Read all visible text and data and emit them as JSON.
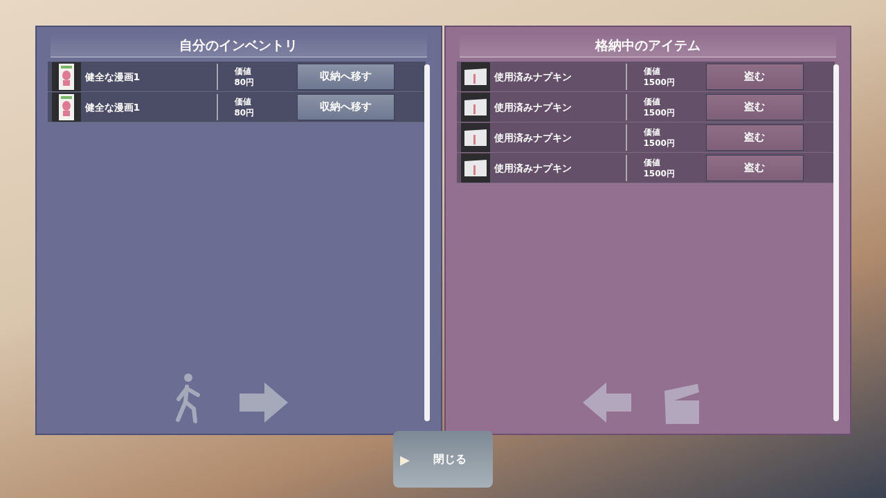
{
  "panels": [
    {
      "kind": "inventory",
      "title": "自分のインベントリ",
      "items": [
        {
          "kind": "comic",
          "name": "健全な漫画1",
          "value_label": "価値",
          "value": "80円",
          "action": "収納へ移す"
        },
        {
          "kind": "comic",
          "name": "健全な漫画1",
          "value_label": "価値",
          "value": "80円",
          "action": "収納へ移す"
        }
      ]
    },
    {
      "kind": "storage",
      "title": "格納中のアイテム",
      "items": [
        {
          "kind": "napkin",
          "name": "使用済みナプキン",
          "value_label": "価値",
          "value": "1500円",
          "action": "盗む"
        },
        {
          "kind": "napkin",
          "name": "使用済みナプキン",
          "value_label": "価値",
          "value": "1500円",
          "action": "盗む"
        },
        {
          "kind": "napkin",
          "name": "使用済みナプキン",
          "value_label": "価値",
          "value": "1500円",
          "action": "盗む"
        },
        {
          "kind": "napkin",
          "name": "使用済みナプキン",
          "value_label": "価値",
          "value": "1500円",
          "action": "盗む"
        }
      ]
    }
  ],
  "close_button": {
    "icon": "▶",
    "label": "閉じる"
  }
}
